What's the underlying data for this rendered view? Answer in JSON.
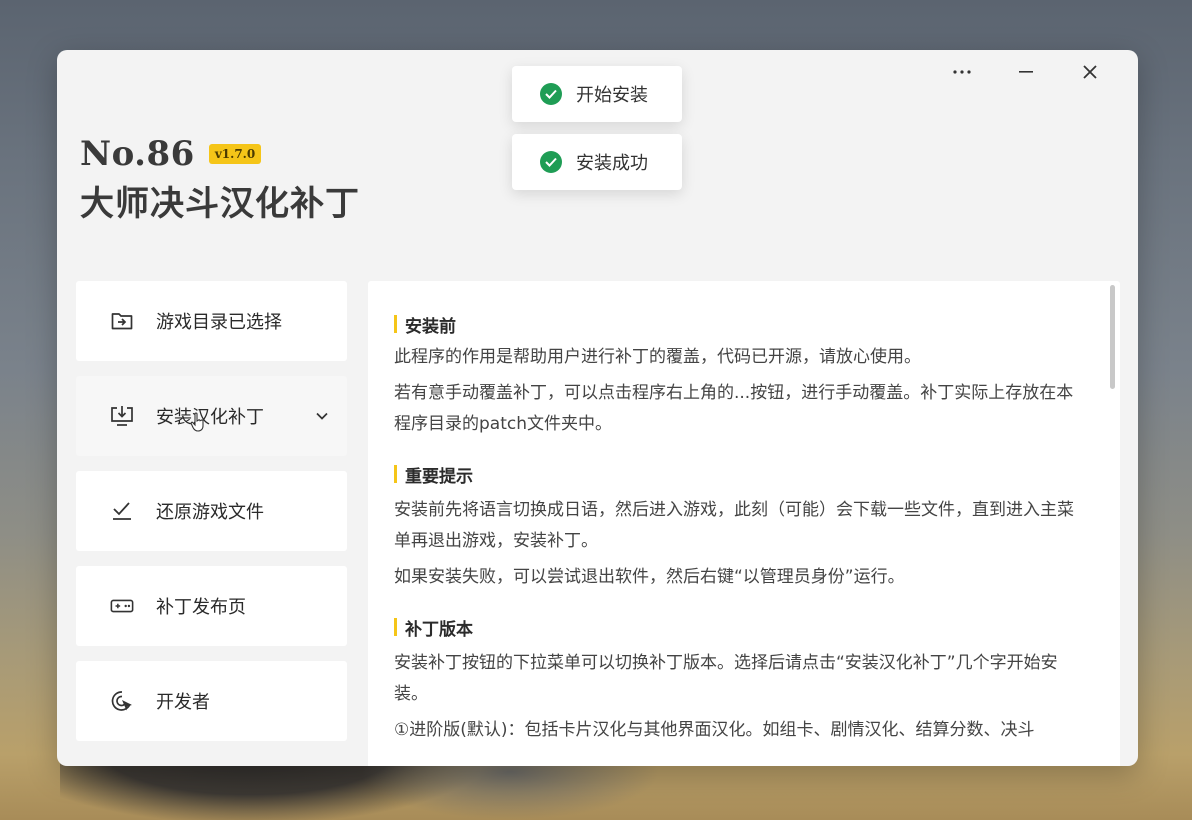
{
  "window": {
    "controls": {
      "more": "···",
      "minimize": "—",
      "close": "✕"
    }
  },
  "brand": {
    "number": "No.86",
    "version": "v1.7.0",
    "title": "大师决斗汉化补丁"
  },
  "toasts": [
    {
      "text": "开始安装",
      "status": "success"
    },
    {
      "text": "安装成功",
      "status": "success"
    }
  ],
  "sidebar": {
    "items": [
      {
        "label": "游戏目录已选择",
        "icon": "folder-arrow-icon"
      },
      {
        "label": "安装汉化补丁",
        "icon": "download-to-screen-icon",
        "has_dropdown": true
      },
      {
        "label": "还原游戏文件",
        "icon": "checkmark-underline-icon"
      },
      {
        "label": "补丁发布页",
        "icon": "gamepad-icon"
      },
      {
        "label": "开发者",
        "icon": "cursor-click-icon"
      }
    ]
  },
  "content": {
    "sections": [
      {
        "heading": "安装前",
        "paragraphs": [
          "此程序的作用是帮助用户进行补丁的覆盖，代码已开源，请放心使用。",
          "若有意手动覆盖补丁，可以点击程序右上角的...按钮，进行手动覆盖。补丁实际上存放在本程序目录的patch文件夹中。"
        ]
      },
      {
        "heading": "重要提示",
        "paragraphs": [
          "安装前先将语言切换成日语，然后进入游戏，此刻（可能）会下载一些文件，直到进入主菜单再退出游戏，安装补丁。",
          "如果安装失败，可以尝试退出软件，然后右键“以管理员身份”运行。"
        ]
      },
      {
        "heading": "补丁版本",
        "paragraphs": [
          "安装补丁按钮的下拉菜单可以切换补丁版本。选择后请点击“安装汉化补丁”几个字开始安装。",
          "①进阶版(默认)：包括卡片汉化与其他界面汉化。如组卡、剧情汉化、结算分数、决斗"
        ]
      }
    ]
  },
  "colors": {
    "accent": "#f5c518",
    "success": "#1f9d55",
    "window_bg": "#f3f3f3",
    "card_bg": "#ffffff"
  }
}
